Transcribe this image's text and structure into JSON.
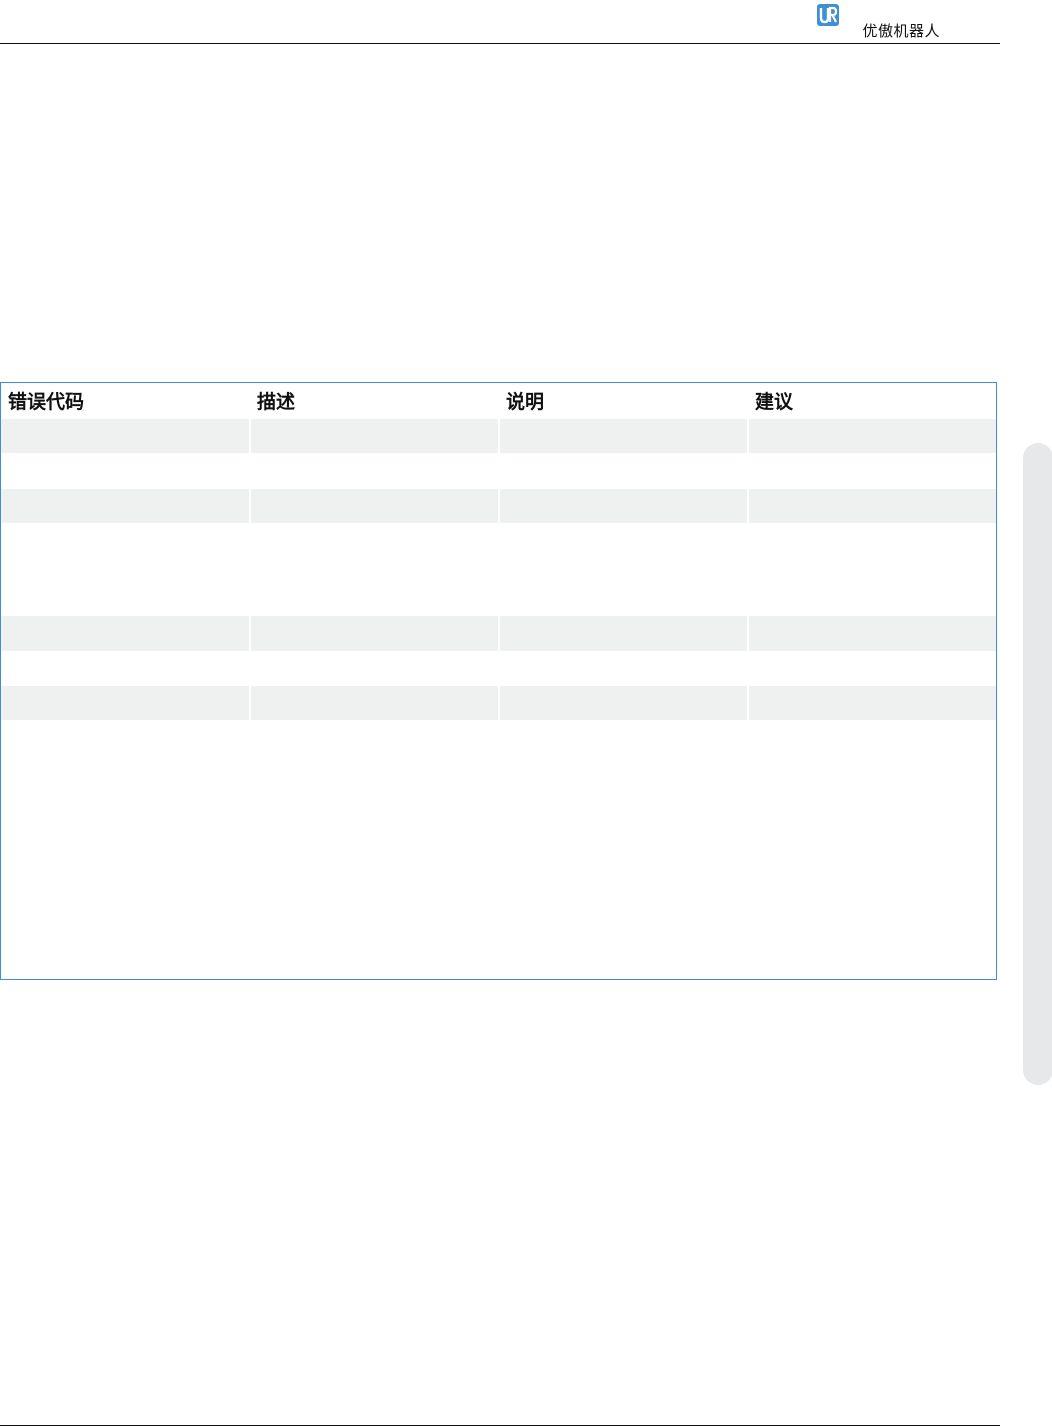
{
  "header": {
    "brand_text": "优傲机器人",
    "logo_icon": "ur-logo-icon",
    "logo_color": "#3f8fd2"
  },
  "table": {
    "border_color": "#3f8fd2",
    "shade_color": "#eff0f0",
    "columns": [
      "错误代码",
      "描述",
      "说明",
      "建议"
    ],
    "rows": [
      {
        "shaded": true,
        "cells": [
          "",
          "",
          "",
          ""
        ]
      },
      {
        "shaded": false,
        "cells": [
          "",
          "",
          "",
          ""
        ]
      },
      {
        "shaded": true,
        "cells": [
          "",
          "",
          "",
          ""
        ]
      },
      {
        "shaded": false,
        "cells": [
          "",
          "",
          "",
          ""
        ]
      },
      {
        "shaded": true,
        "cells": [
          "",
          "",
          "",
          ""
        ]
      },
      {
        "shaded": false,
        "cells": [
          "",
          "",
          "",
          ""
        ]
      },
      {
        "shaded": true,
        "cells": [
          "",
          "",
          "",
          ""
        ]
      },
      {
        "shaded": false,
        "cells": [
          "",
          "",
          "",
          ""
        ]
      }
    ]
  }
}
